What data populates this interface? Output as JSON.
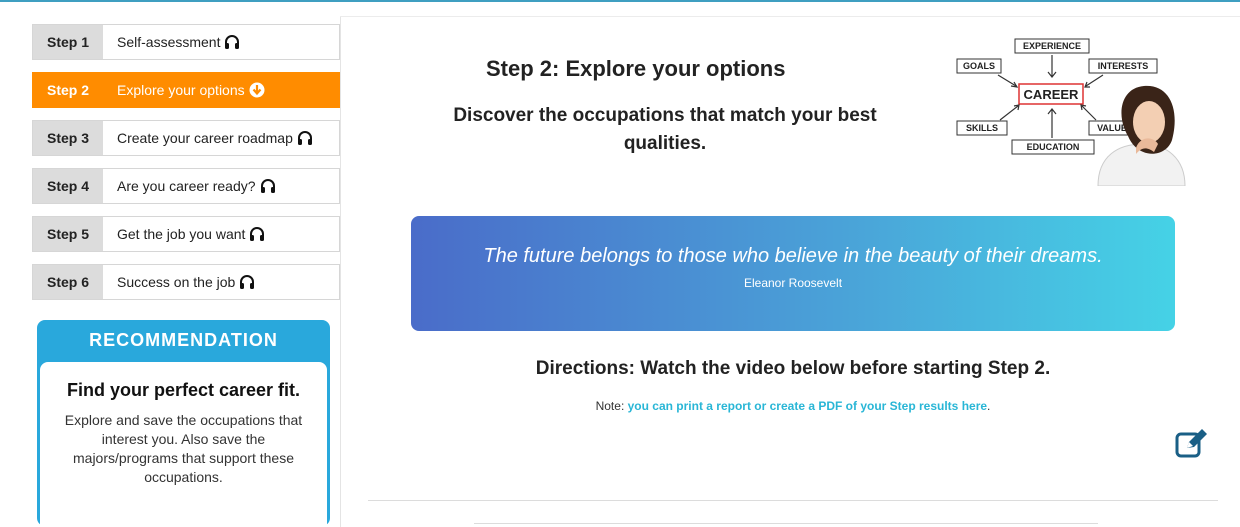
{
  "steps": [
    {
      "num": "Step 1",
      "label": "Self-assessment",
      "icon": "headphones-icon",
      "active": false
    },
    {
      "num": "Step 2",
      "label": "Explore your options",
      "icon": "arrow-down-circle-icon",
      "active": true
    },
    {
      "num": "Step 3",
      "label": "Create your career roadmap",
      "icon": "headphones-icon",
      "active": false
    },
    {
      "num": "Step 4",
      "label": "Are you career ready?",
      "icon": "headphones-icon",
      "active": false
    },
    {
      "num": "Step 5",
      "label": "Get the job you want",
      "icon": "headphones-icon",
      "active": false
    },
    {
      "num": "Step 6",
      "label": "Success on the job",
      "icon": "headphones-icon",
      "active": false
    }
  ],
  "recommendation": {
    "title": "RECOMMENDATION",
    "heading": "Find your perfect career fit.",
    "text": "Explore and save the occupations that interest you. Also save the majors/programs that support these occupations."
  },
  "main": {
    "title": "Step 2: Explore your options",
    "subtitle": "Discover the occupations that match your best qualities.",
    "diagram": {
      "center": "CAREER",
      "labels": [
        "EXPERIENCE",
        "GOALS",
        "INTERESTS",
        "SKILLS",
        "VALUES",
        "EDUCATION"
      ]
    },
    "quote": {
      "text": "The future belongs to those who believe in the beauty of their dreams.",
      "author": "Eleanor Roosevelt"
    },
    "directions": "Directions: Watch the video below before starting Step 2.",
    "note_prefix": "Note: ",
    "note_link": "you can print a report or create a PDF of your Step results here",
    "note_suffix": ".",
    "edit_icon": "edit-icon"
  },
  "colors": {
    "active": "#ff8c00",
    "accent": "#29a8dc",
    "link": "#29b6d6"
  }
}
